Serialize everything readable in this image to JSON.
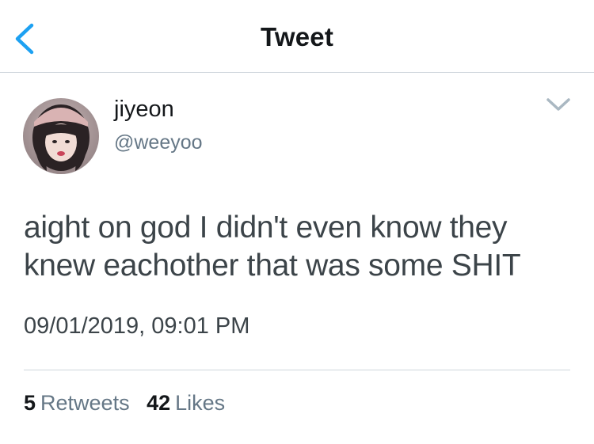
{
  "navbar": {
    "title": "Tweet"
  },
  "tweet": {
    "display_name": "jiyeon",
    "handle": "@weeyoo",
    "text": "aight on god I didn't even know they knew eachother that was some SHIT",
    "timestamp": "09/01/2019, 09:01 PM",
    "stats": {
      "retweets_count": "5",
      "retweets_label": "Retweets",
      "likes_count": "42",
      "likes_label": "Likes"
    }
  },
  "icons": {
    "back": "chevron-left-icon",
    "menu": "chevron-down-icon"
  },
  "colors": {
    "accent": "#1da1f2",
    "primary_text": "#14171a",
    "secondary_text": "#657786",
    "divider": "#cfd6dc"
  }
}
